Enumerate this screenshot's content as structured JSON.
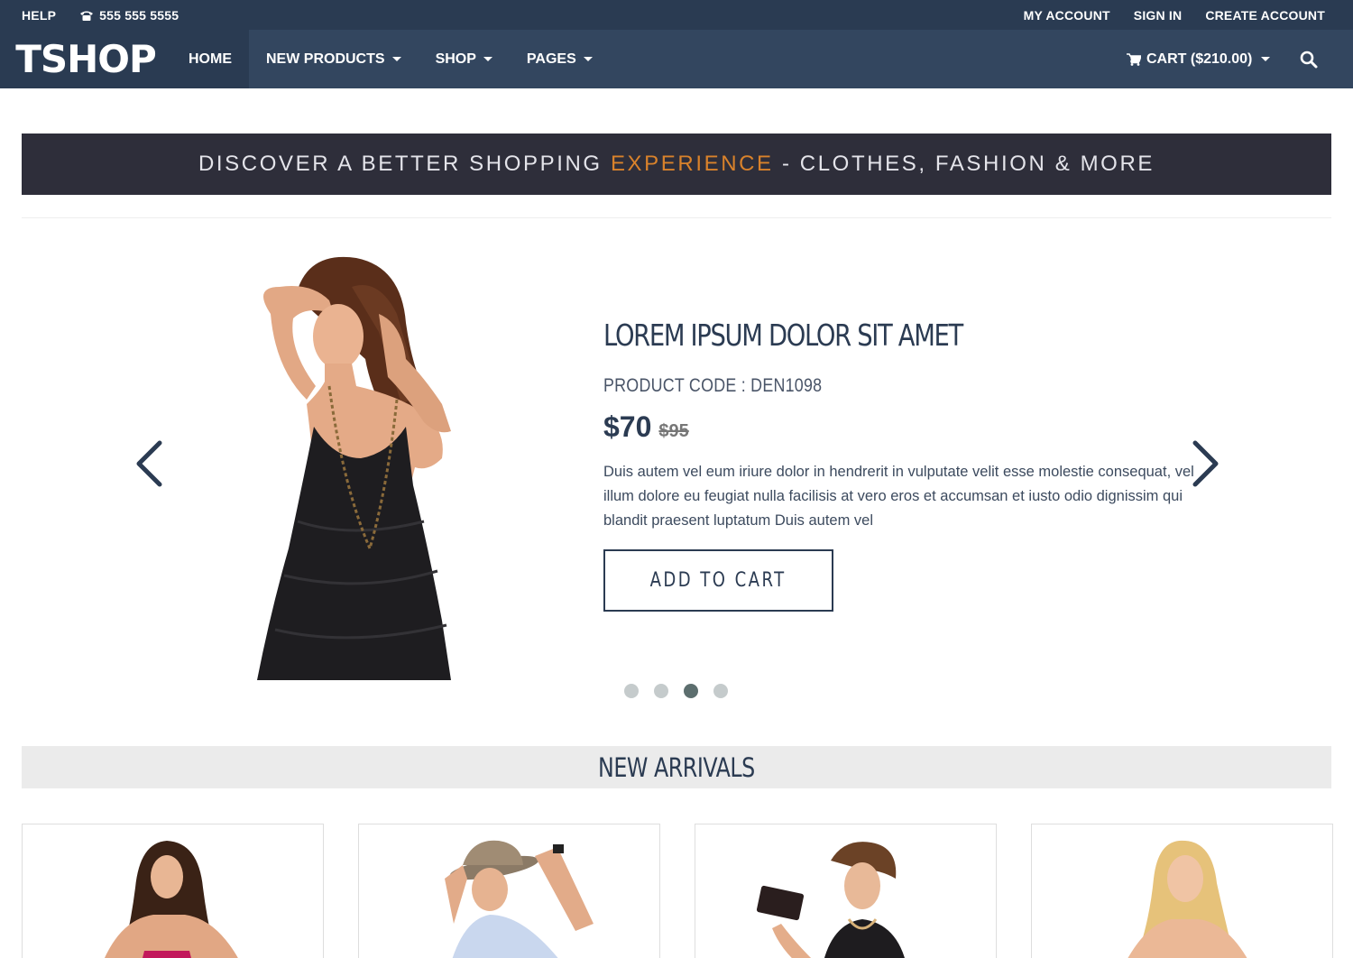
{
  "topbar": {
    "help": "HELP",
    "phone": "555 555 5555",
    "my_account": "MY ACCOUNT",
    "sign_in": "SIGN IN",
    "create_account": "CREATE ACCOUNT"
  },
  "nav": {
    "brand": "TSHOP",
    "items": [
      "HOME",
      "NEW PRODUCTS",
      "SHOP",
      "PAGES"
    ],
    "cart": "CART ($210.00)"
  },
  "banner": {
    "text_before": "DISCOVER A BETTER SHOPPING ",
    "text_highlight": "EXPERIENCE",
    "text_after": " - CLOTHES, FASHION & MORE",
    "highlight_color": "#d9822b"
  },
  "slider": {
    "title": "LOREM IPSUM DOLOR SIT AMET",
    "product_code": "PRODUCT CODE : DEN1098",
    "price_now": "$70",
    "price_was": "$95",
    "description": "Duis autem vel eum iriure dolor in hendrerit in vulputate velit esse molestie consequat, vel illum dolore eu feugiat nulla facilisis at vero eros et accumsan et iusto odio dignissim qui blandit praesent luptatum Duis autem vel",
    "button": "ADD TO CART",
    "active_slide": 3,
    "slide_count": 4
  },
  "new_arrivals": {
    "title": "NEW ARRIVALS"
  },
  "colors": {
    "topbar": "#2a3b52",
    "navbar": "#33465f",
    "banner": "#2e2e3a",
    "heading": "#2b3b52"
  }
}
